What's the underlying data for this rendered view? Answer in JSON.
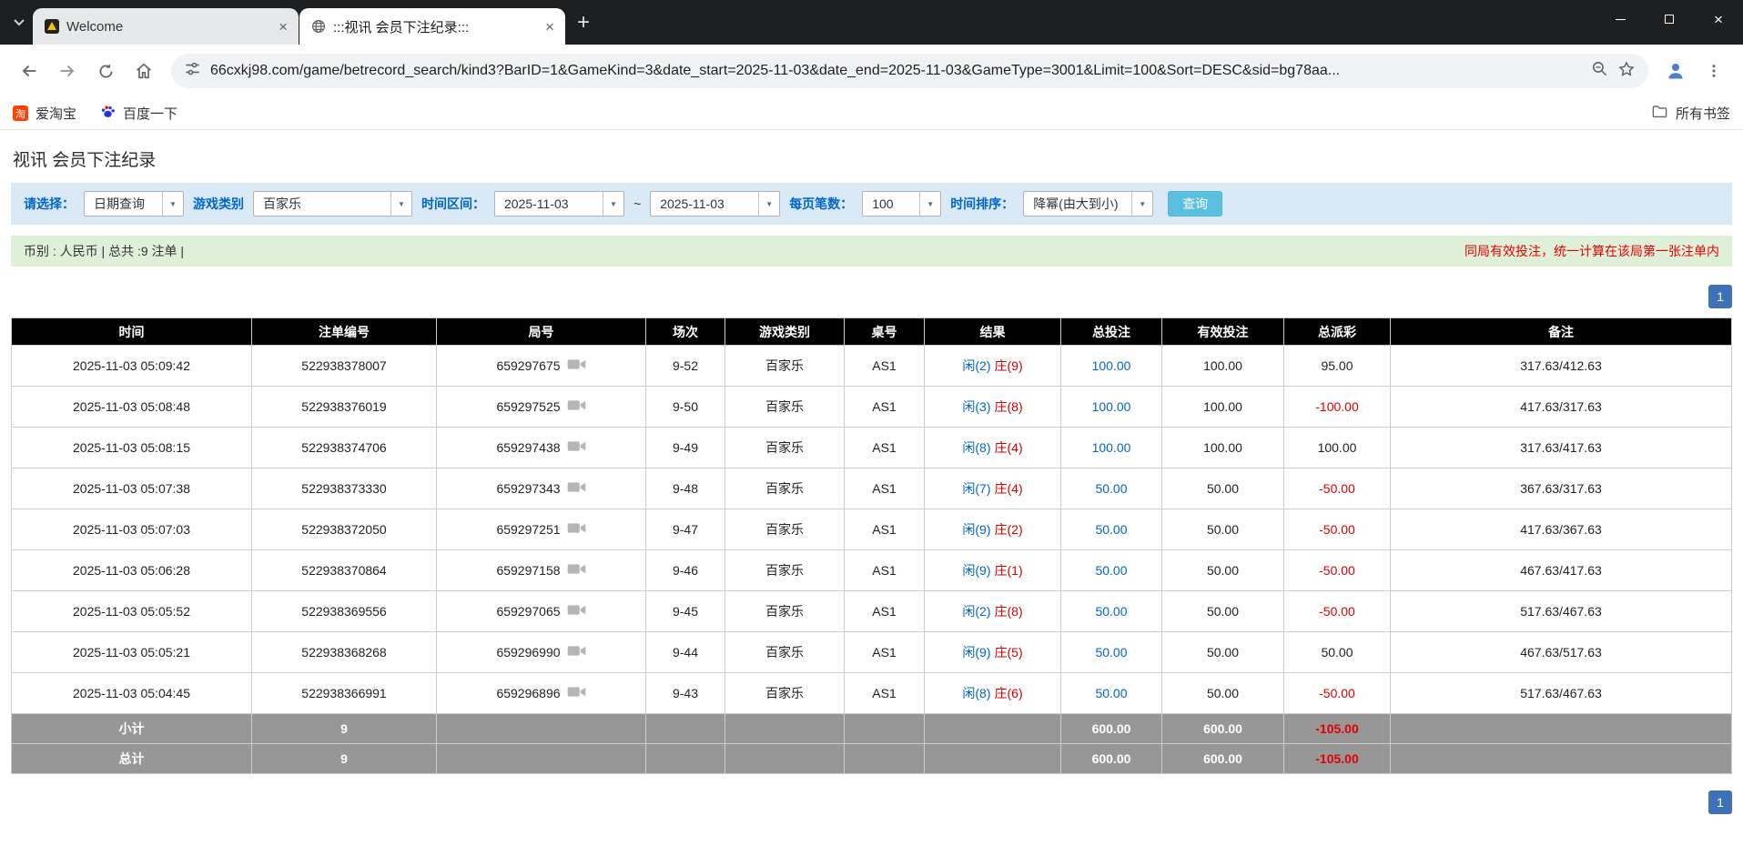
{
  "browser": {
    "tabs": [
      {
        "title": "Welcome"
      },
      {
        "title": ":::视讯 会员下注纪录:::"
      }
    ],
    "url": "66cxkj98.com/game/betrecord_search/kind3?BarID=1&GameKind=3&date_start=2025-11-03&date_end=2025-11-03&GameType=3001&Limit=100&Sort=DESC&sid=bg78aa...",
    "bookmarks": [
      {
        "label": "爱淘宝",
        "badge": "淘"
      },
      {
        "label": "百度一下"
      }
    ],
    "all_bookmarks": "所有书签"
  },
  "page": {
    "title": "视讯 会员下注纪录",
    "filters": {
      "select_label": "请选择：",
      "select_value": "日期查询",
      "game_label": "游戏类别",
      "game_value": "百家乐",
      "range_label": "时间区间：",
      "date_start": "2025-11-03",
      "range_separator": "~",
      "date_end": "2025-11-03",
      "per_page_label": "每页笔数：",
      "per_page_value": "100",
      "sort_label": "时间排序：",
      "sort_value": "降幂(由大到小)",
      "search_button": "查询"
    },
    "summary_left": "币别 : 人民币 | 总共 :9 注单 |",
    "summary_right": "同局有效投注，统一计算在该局第一张注单内",
    "pagination": "1",
    "table": {
      "headers": [
        "时间",
        "注单编号",
        "局号",
        "场次",
        "游戏类别",
        "桌号",
        "结果",
        "总投注",
        "有效投注",
        "总派彩",
        "备注"
      ],
      "rows": [
        {
          "time": "2025-11-03 05:09:42",
          "bet_id": "522938378007",
          "round_id": "659297675",
          "session": "9-52",
          "game": "百家乐",
          "table_no": "AS1",
          "result_player": "闲(2)",
          "result_banker": "庄(9)",
          "total_bet": "100.00",
          "valid_bet": "100.00",
          "payout": "95.00",
          "note": "317.63/412.63"
        },
        {
          "time": "2025-11-03 05:08:48",
          "bet_id": "522938376019",
          "round_id": "659297525",
          "session": "9-50",
          "game": "百家乐",
          "table_no": "AS1",
          "result_player": "闲(3)",
          "result_banker": "庄(8)",
          "total_bet": "100.00",
          "valid_bet": "100.00",
          "payout": "-100.00",
          "note": "417.63/317.63"
        },
        {
          "time": "2025-11-03 05:08:15",
          "bet_id": "522938374706",
          "round_id": "659297438",
          "session": "9-49",
          "game": "百家乐",
          "table_no": "AS1",
          "result_player": "闲(8)",
          "result_banker": "庄(4)",
          "total_bet": "100.00",
          "valid_bet": "100.00",
          "payout": "100.00",
          "note": "317.63/417.63"
        },
        {
          "time": "2025-11-03 05:07:38",
          "bet_id": "522938373330",
          "round_id": "659297343",
          "session": "9-48",
          "game": "百家乐",
          "table_no": "AS1",
          "result_player": "闲(7)",
          "result_banker": "庄(4)",
          "total_bet": "50.00",
          "valid_bet": "50.00",
          "payout": "-50.00",
          "note": "367.63/317.63"
        },
        {
          "time": "2025-11-03 05:07:03",
          "bet_id": "522938372050",
          "round_id": "659297251",
          "session": "9-47",
          "game": "百家乐",
          "table_no": "AS1",
          "result_player": "闲(9)",
          "result_banker": "庄(2)",
          "total_bet": "50.00",
          "valid_bet": "50.00",
          "payout": "-50.00",
          "note": "417.63/367.63"
        },
        {
          "time": "2025-11-03 05:06:28",
          "bet_id": "522938370864",
          "round_id": "659297158",
          "session": "9-46",
          "game": "百家乐",
          "table_no": "AS1",
          "result_player": "闲(9)",
          "result_banker": "庄(1)",
          "total_bet": "50.00",
          "valid_bet": "50.00",
          "payout": "-50.00",
          "note": "467.63/417.63"
        },
        {
          "time": "2025-11-03 05:05:52",
          "bet_id": "522938369556",
          "round_id": "659297065",
          "session": "9-45",
          "game": "百家乐",
          "table_no": "AS1",
          "result_player": "闲(2)",
          "result_banker": "庄(8)",
          "total_bet": "50.00",
          "valid_bet": "50.00",
          "payout": "-50.00",
          "note": "517.63/467.63"
        },
        {
          "time": "2025-11-03 05:05:21",
          "bet_id": "522938368268",
          "round_id": "659296990",
          "session": "9-44",
          "game": "百家乐",
          "table_no": "AS1",
          "result_player": "闲(9)",
          "result_banker": "庄(5)",
          "total_bet": "50.00",
          "valid_bet": "50.00",
          "payout": "50.00",
          "note": "467.63/517.63"
        },
        {
          "time": "2025-11-03 05:04:45",
          "bet_id": "522938366991",
          "round_id": "659296896",
          "session": "9-43",
          "game": "百家乐",
          "table_no": "AS1",
          "result_player": "闲(8)",
          "result_banker": "庄(6)",
          "total_bet": "50.00",
          "valid_bet": "50.00",
          "payout": "-50.00",
          "note": "517.63/467.63"
        }
      ],
      "subtotal": {
        "label": "小计",
        "count": "9",
        "total_bet": "600.00",
        "valid_bet": "600.00",
        "payout": "-105.00"
      },
      "total": {
        "label": "总计",
        "count": "9",
        "total_bet": "600.00",
        "valid_bet": "600.00",
        "payout": "-105.00"
      }
    }
  },
  "colors": {
    "accent_blue": "#0066cc",
    "negative_red": "#dd0000",
    "filter_bg": "#d9e9f6",
    "summary_bg": "#dff0d8",
    "table_header_bg": "#000000",
    "table_footer_bg": "#979797",
    "pagination_bg": "#3d72b8",
    "search_button_bg": "#5bc0de"
  }
}
